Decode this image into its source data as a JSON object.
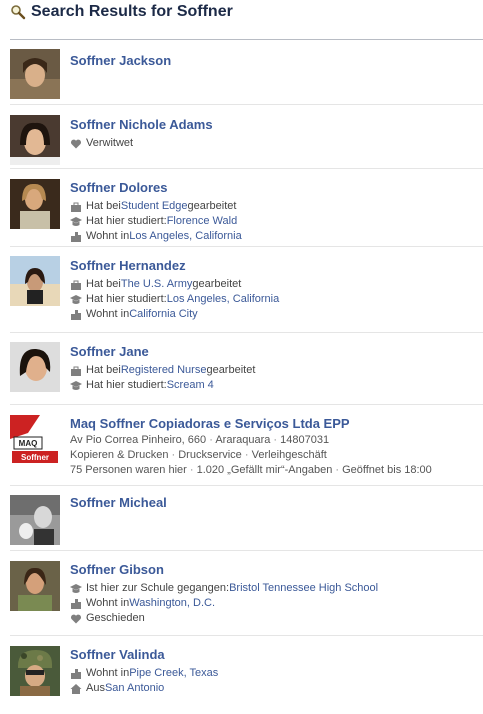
{
  "header": {
    "title": "Search Results for Soffner",
    "icon": "magnifier-icon"
  },
  "results": [
    {
      "name": "Soffner Jackson",
      "details": []
    },
    {
      "name": "Soffner Nichole Adams",
      "details": [
        {
          "icon": "heart-icon",
          "text": "Verwitwet"
        }
      ]
    },
    {
      "name": "Soffner Dolores",
      "details": [
        {
          "icon": "briefcase-icon",
          "pre": "Hat bei ",
          "link": "Student Edge",
          "post": " gearbeitet"
        },
        {
          "icon": "graduation-cap-icon",
          "pre": "Hat hier studiert: ",
          "link": "Florence Wald",
          "post": ""
        },
        {
          "icon": "city-icon",
          "pre": "Wohnt in ",
          "link": "Los Angeles, California",
          "post": ""
        }
      ]
    },
    {
      "name": "Soffner Hernandez",
      "details": [
        {
          "icon": "briefcase-icon",
          "pre": "Hat bei ",
          "link": "The U.S. Army",
          "post": " gearbeitet"
        },
        {
          "icon": "graduation-cap-icon",
          "pre": "Hat hier studiert: ",
          "link": "Los Angeles, California",
          "post": ""
        },
        {
          "icon": "city-icon",
          "pre": "Wohnt in ",
          "link": "California City",
          "post": ""
        }
      ]
    },
    {
      "name": "Soffner Jane",
      "details": [
        {
          "icon": "briefcase-icon",
          "pre": "Hat bei ",
          "link": "Registered Nurse",
          "post": " gearbeitet"
        },
        {
          "icon": "graduation-cap-icon",
          "pre": "Hat hier studiert: ",
          "link": "Scream 4",
          "post": ""
        }
      ]
    },
    {
      "name": "Maq Soffner Copiadoras e Serviços Ltda EPP",
      "page": {
        "address": [
          "Av Pio Correa Pinheiro, 660",
          "Araraquara",
          "14807031"
        ],
        "categories": [
          "Kopieren & Drucken",
          "Druckservice",
          "Verleihgeschäft"
        ],
        "stats": [
          "75 Personen waren hier",
          "1.020 „Gefällt mir“-Angaben",
          "Geöffnet bis 18:00"
        ],
        "logo_text_top": "MAQ",
        "logo_text_bottom": "Soffner"
      }
    },
    {
      "name": "Soffner Micheal",
      "details": []
    },
    {
      "name": "Soffner Gibson",
      "details": [
        {
          "icon": "graduation-cap-icon",
          "pre": "Ist hier zur Schule gegangen: ",
          "link": "Bristol Tennessee High School",
          "post": ""
        },
        {
          "icon": "city-icon",
          "pre": "Wohnt in ",
          "link": "Washington, D.C.",
          "post": ""
        },
        {
          "icon": "heart-icon",
          "text": "Geschieden"
        }
      ]
    },
    {
      "name": "Soffner Valinda",
      "details": [
        {
          "icon": "city-icon",
          "pre": "Wohnt in ",
          "link": "Pipe Creek, Texas",
          "post": ""
        },
        {
          "icon": "home-icon",
          "pre": "Aus ",
          "link": "San Antonio",
          "post": ""
        }
      ]
    }
  ]
}
